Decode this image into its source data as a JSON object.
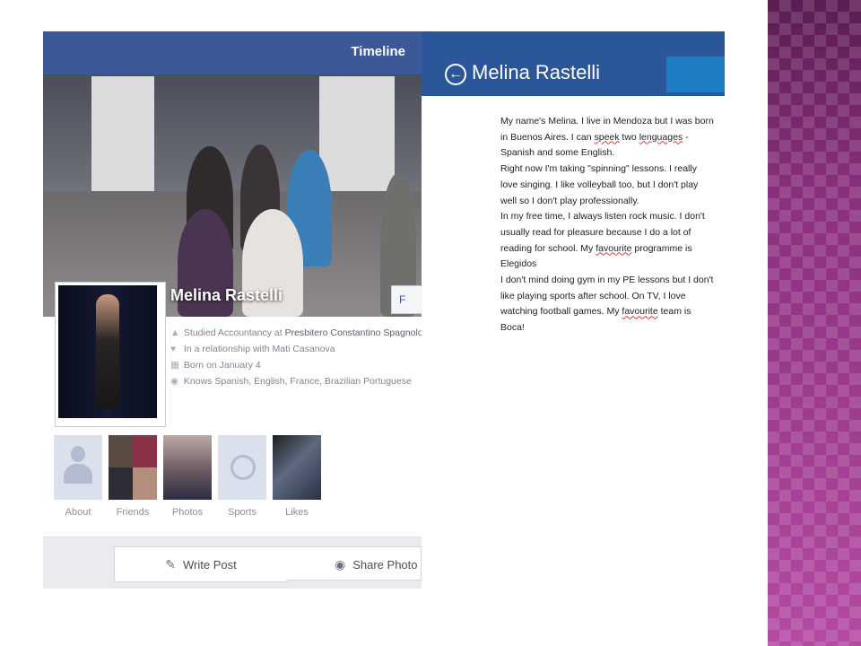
{
  "facebook": {
    "topbar_title": "Timeline",
    "profile_name": "Melina Rastelli",
    "cover_button_label": "F",
    "info": [
      {
        "icon": "graduation-cap-icon",
        "prefix": "Studied Accountancy at ",
        "highlight": "Presbitero Constantino Spagnolo"
      },
      {
        "icon": "heart-icon",
        "prefix": "In a relationship with Mati Casanova",
        "highlight": ""
      },
      {
        "icon": "calendar-icon",
        "prefix": "Born on January 4",
        "highlight": ""
      },
      {
        "icon": "globe-icon",
        "prefix": "Knows Spanish, English, France, Brazilian Portuguese",
        "highlight": ""
      }
    ],
    "tiles": [
      {
        "label": "About"
      },
      {
        "label": "Friends"
      },
      {
        "label": "Photos"
      },
      {
        "label": "Sports"
      },
      {
        "label": "Likes"
      }
    ],
    "write_post_label": "Write Post",
    "share_photo_label": "Share Photo"
  },
  "document": {
    "title": "Melina Rastelli",
    "p1_a": "My name's Melina. I live in Mendoza but I was born in Buenos Aires. I can ",
    "p1_speek": "speek",
    "p1_b": " two ",
    "p1_lenguages": "lenguages",
    "p1_c": " - Spanish and some English.",
    "p2": "Right now I'm taking \"spinning\" lessons. I really love singing. I like volleyball too, but I don't play well so I don't play professionally.",
    "p3_a": "In my free time, I always listen rock music. I don't usually read for pleasure because I do a lot of reading for school. My ",
    "p3_fav": "favourite",
    "p3_b": " programme is Elegidos",
    "p4_a": "I don't mind doing gym in my PE lessons but I don't like playing sports after school. On TV, I love watching football games. My ",
    "p4_fav": "favourite",
    "p4_b": " team is Boca!"
  },
  "colors": {
    "facebook_blue": "#3b5998",
    "word_header_blue": "#2b579a",
    "accent_square": "#1e7cc4",
    "decor_purple": "#a33a94"
  }
}
